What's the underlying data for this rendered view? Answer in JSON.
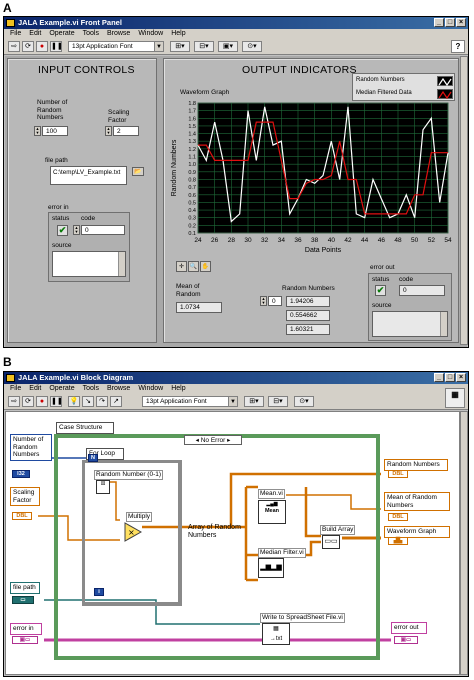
{
  "panel_a": {
    "letter": "A"
  },
  "panel_b": {
    "letter": "B"
  },
  "front_panel": {
    "title": "JALA Example.vi Front Panel",
    "menu": [
      "File",
      "Edit",
      "Operate",
      "Tools",
      "Browse",
      "Window",
      "Help"
    ],
    "font_select": "13pt Application Font",
    "input_header": "INPUT CONTROLS",
    "output_header": "OUTPUT INDICATORS",
    "num_random_label": "Number of Random Numbers",
    "num_random_value": "100",
    "scaling_label": "Scaling Factor",
    "scaling_value": "2",
    "file_path_label": "file path",
    "file_path_value": "C:\\temp\\LV_Example.txt",
    "error_in_label": "error in",
    "status_label": "status",
    "code_label": "code",
    "code_value": "0",
    "source_label": "source",
    "graph_title": "Waveform Graph",
    "legend": [
      "Random Numbers",
      "Median Filtered Data"
    ],
    "mean_label": "Mean of Random",
    "mean_value": "1.0734",
    "random_array_label": "Random Numbers",
    "random_index": "0",
    "random_values": [
      "1.94206",
      "0.554662",
      "1.60321"
    ],
    "error_out_label": "error out",
    "error_out_status": "status",
    "error_out_code_label": "code",
    "error_out_code": "0",
    "error_out_source": "source"
  },
  "block_diagram": {
    "title": "JALA Example.vi Block Diagram",
    "menu": [
      "File",
      "Edit",
      "Operate",
      "Tools",
      "Browse",
      "Window",
      "Help"
    ],
    "font_select": "13pt Application Font",
    "num_random_label": "Number of Random Numbers",
    "num_random_type": "I32",
    "scaling_label": "Scaling Factor",
    "scaling_type": "DBL",
    "file_path_label": "file path",
    "error_in_label": "error in",
    "case_label": "Case Structure",
    "case_selector": "No Error",
    "for_loop_label": "For Loop",
    "for_n": "N",
    "for_i": "i",
    "random_node_label": "Random Number (0-1)",
    "multiply_label": "Multiply",
    "array_label": "Array of Random Numbers",
    "mean_vi": "Mean.vi",
    "mean_icon": "Mean",
    "median_vi": "Median Filter.vi",
    "build_array": "Build Array",
    "write_vi": "Write to SpreadSheet File.vi",
    "out_random": "Random Numbers",
    "out_mean": "Mean of Random Numbers",
    "out_graph": "Waveform Graph",
    "error_out_label": "error out",
    "dbl": "DBL"
  },
  "chart_data": {
    "type": "line",
    "title": "Waveform Graph",
    "xlabel": "Data Points",
    "ylabel": "Random Numbers",
    "xlim": [
      24,
      54
    ],
    "ylim": [
      0.1,
      1.8
    ],
    "x_ticks": [
      24,
      26,
      28,
      30,
      32,
      34,
      36,
      38,
      40,
      42,
      44,
      46,
      48,
      50,
      52,
      54
    ],
    "y_ticks": [
      0.1,
      0.2,
      0.3,
      0.4,
      0.5,
      0.6,
      0.7,
      0.8,
      0.9,
      1.0,
      1.1,
      1.2,
      1.3,
      1.4,
      1.5,
      1.6,
      1.7,
      1.8
    ],
    "grid": true,
    "legend_position": "top-right",
    "series": [
      {
        "name": "Random Numbers",
        "color": "#ffffff",
        "x": [
          24,
          25,
          26,
          27,
          28,
          29,
          30,
          31,
          32,
          33,
          34,
          35,
          36,
          37,
          38,
          39,
          40,
          41,
          42,
          43,
          44,
          45,
          46,
          47,
          48,
          49,
          50,
          51,
          52,
          53,
          54
        ],
        "y": [
          1.25,
          1.05,
          1.55,
          1.05,
          0.25,
          0.35,
          1.7,
          1.05,
          1.75,
          1.25,
          1.3,
          0.35,
          0.55,
          0.8,
          0.75,
          0.85,
          1.3,
          0.8,
          1.75,
          0.35,
          0.3,
          0.8,
          0.55,
          0.3,
          0.35,
          0.6,
          0.3,
          1.45,
          1.6,
          0.5,
          1.15
        ]
      },
      {
        "name": "Median Filtered Data",
        "color": "#e01010",
        "x": [
          24,
          25,
          26,
          27,
          28,
          29,
          30,
          31,
          32,
          33,
          34,
          35,
          36,
          37,
          38,
          39,
          40,
          41,
          42,
          43,
          44,
          45,
          46,
          47,
          48,
          49,
          50,
          51,
          52,
          53,
          54
        ],
        "y": [
          1.25,
          1.25,
          1.05,
          1.05,
          1.05,
          1.05,
          1.05,
          1.55,
          1.55,
          1.55,
          1.05,
          0.55,
          0.55,
          0.75,
          0.8,
          0.8,
          0.85,
          1.3,
          0.8,
          0.8,
          0.35,
          0.35,
          0.35,
          0.35,
          0.35,
          0.35,
          0.6,
          0.6,
          1.15,
          1.15,
          1.15
        ]
      }
    ]
  }
}
